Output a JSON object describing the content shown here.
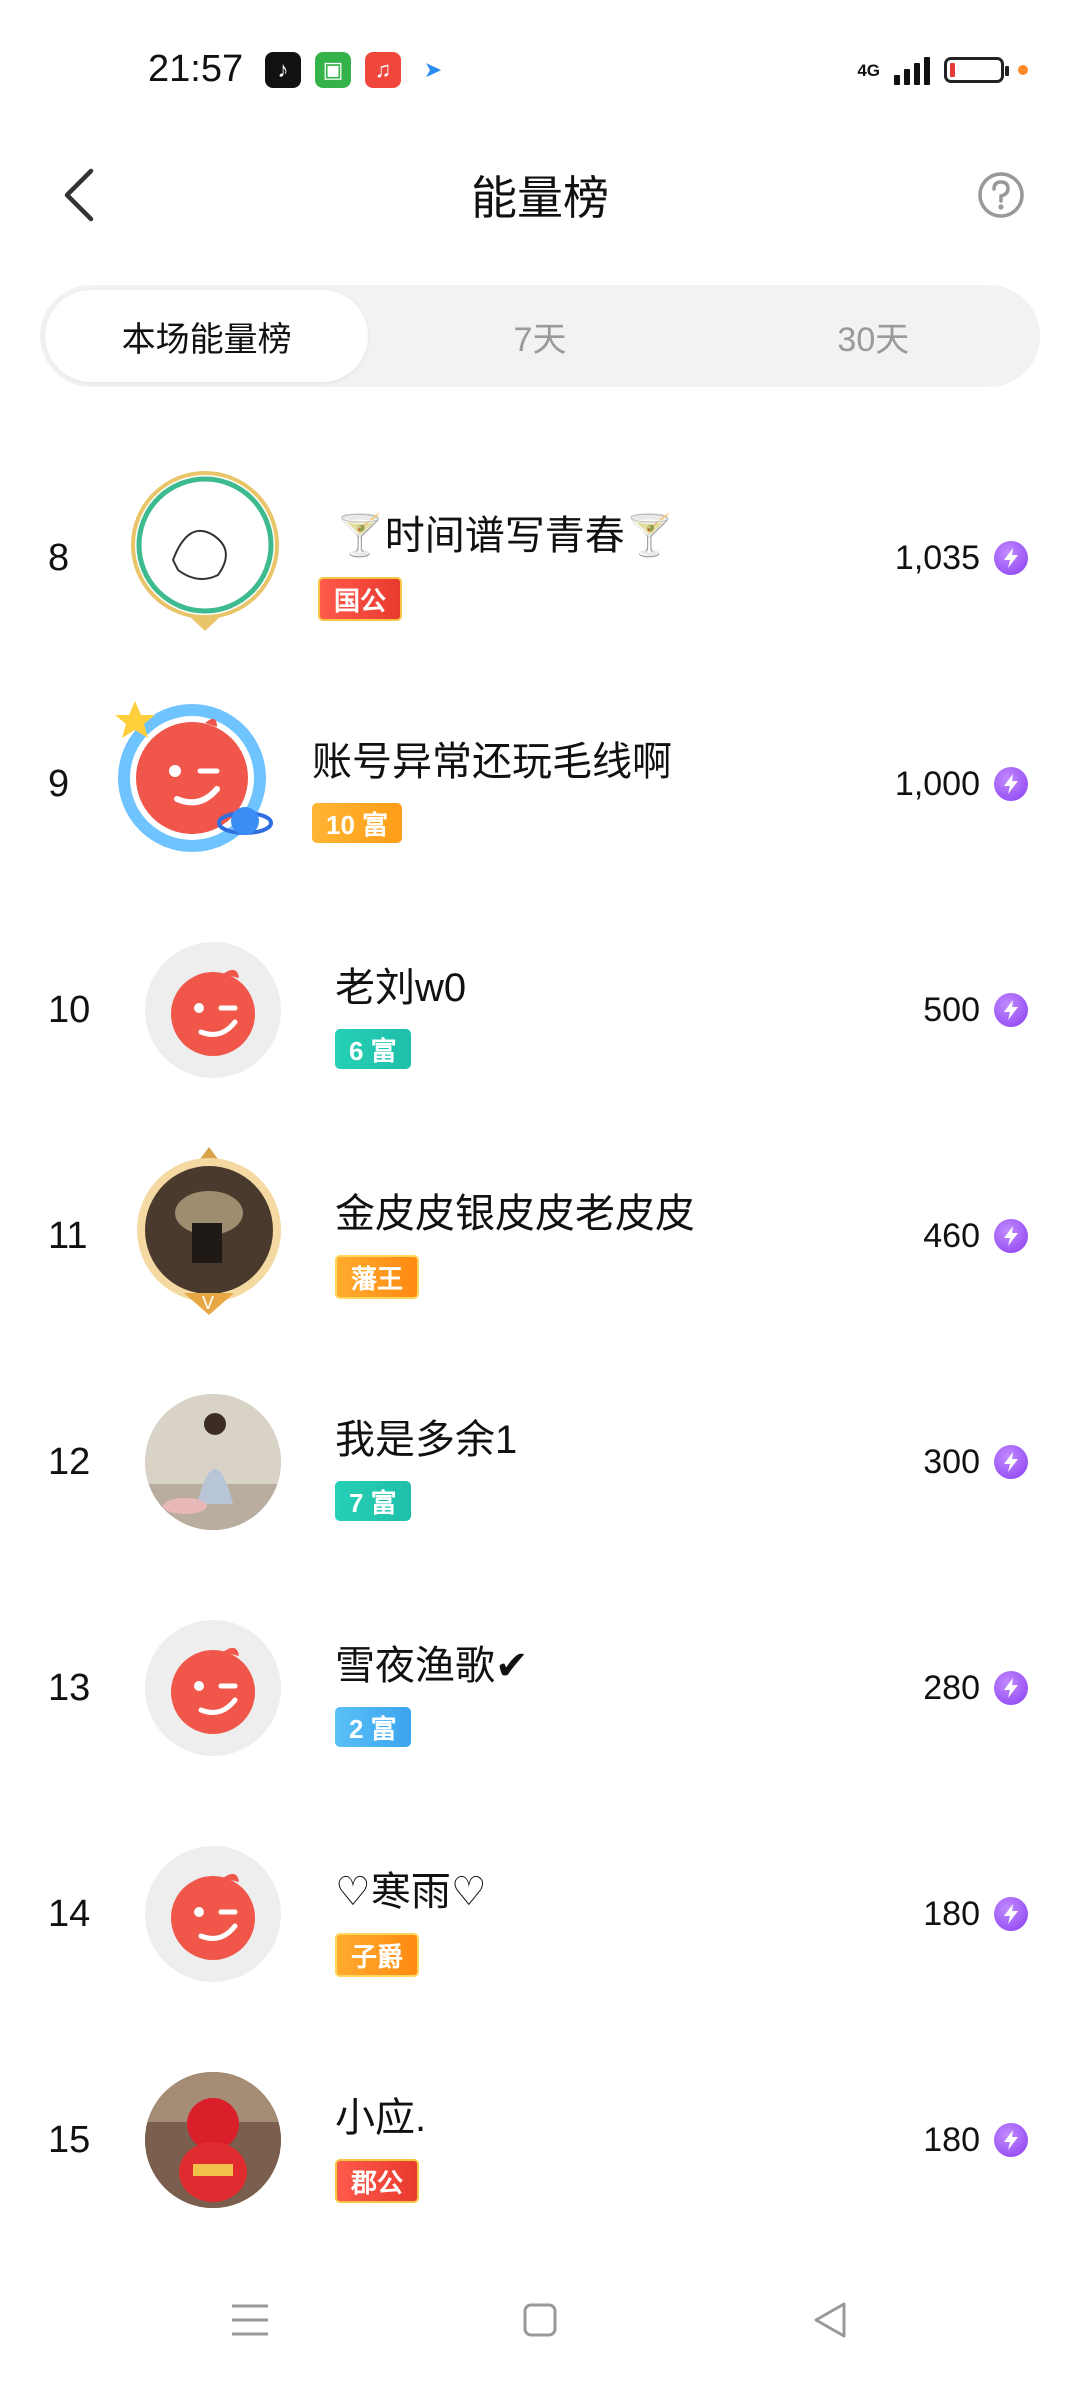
{
  "status_bar": {
    "time": "21:57",
    "network": "4G",
    "apps": [
      "tiktok-icon",
      "shopping-bag-icon",
      "music-icon",
      "send-icon"
    ]
  },
  "header": {
    "title": "能量榜"
  },
  "tabs": [
    {
      "label": "本场能量榜",
      "active": true
    },
    {
      "label": "7天",
      "active": false
    },
    {
      "label": "30天",
      "active": false
    }
  ],
  "rows": [
    {
      "rank": "8",
      "name": "🍸时间谱写青春🍸",
      "badge": "国公",
      "badge_style": "red",
      "score": "1,035"
    },
    {
      "rank": "9",
      "name": "账号异常还玩毛线啊",
      "badge": "10 富",
      "badge_style": "gold",
      "score": "1,000"
    },
    {
      "rank": "10",
      "name": "老刘w0",
      "badge": "6 富",
      "badge_style": "teal",
      "score": "500"
    },
    {
      "rank": "11",
      "name": "金皮皮银皮皮老皮皮",
      "badge": "藩王",
      "badge_style": "orange",
      "score": "460"
    },
    {
      "rank": "12",
      "name": "我是多余1",
      "badge": "7 富",
      "badge_style": "teal",
      "score": "300"
    },
    {
      "rank": "13",
      "name": "雪夜渔歌✔",
      "badge": "2 富",
      "badge_style": "blue",
      "score": "280"
    },
    {
      "rank": "14",
      "name": "♡寒雨♡",
      "badge": "子爵",
      "badge_style": "orange",
      "score": "180"
    },
    {
      "rank": "15",
      "name": "小应.",
      "badge": "郡公",
      "badge_style": "red",
      "score": "180"
    }
  ],
  "colors": {
    "default_avatar": "#f0564a",
    "energy_icon": "#8a3df0",
    "tab_inactive_text": "#9a9a9a"
  }
}
